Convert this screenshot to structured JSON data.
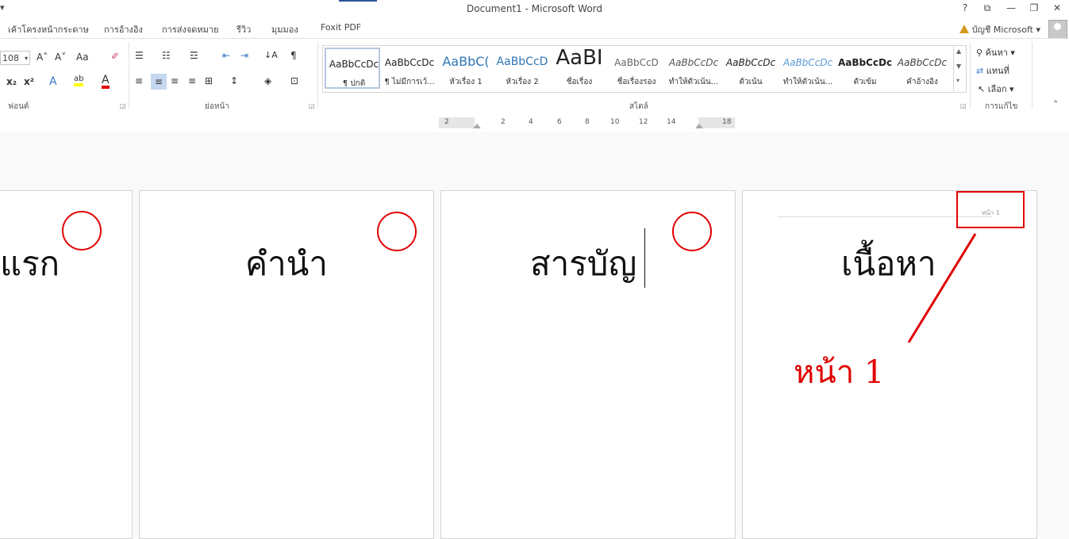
{
  "window": {
    "title": "Document1 - Microsoft Word",
    "help": "?",
    "ribbon_display": "⧉",
    "minimize": "—",
    "restore": "❐",
    "close": "✕"
  },
  "tabs": [
    {
      "label": "เค้าโครงหน้ากระดาษ"
    },
    {
      "label": "การอ้างอิง"
    },
    {
      "label": "การส่งจดหมาย"
    },
    {
      "label": "รีวิว"
    },
    {
      "label": "มุมมอง"
    },
    {
      "label": "Foxit PDF"
    }
  ],
  "account": {
    "label": "บัญชี Microsoft",
    "dropdown": "▾"
  },
  "ribbon": {
    "font": {
      "size_value": "108",
      "grow": "A˄",
      "shrink": "A˅",
      "change_case": "Aa",
      "clear_format": "✐",
      "subscript": "x₂",
      "superscript": "x²",
      "text_effects": "A",
      "highlight": "ab",
      "font_color": "A",
      "label": "ฟอนต์"
    },
    "paragraph": {
      "bullets": "☰",
      "numbering": "☷",
      "multilevel": "☲",
      "decrease_indent": "⇤",
      "increase_indent": "⇥",
      "sort": "↓A",
      "show_marks": "¶",
      "align_left": "≡",
      "align_center": "≡",
      "align_right": "≡",
      "justify": "≡",
      "distributed": "⊞",
      "line_spacing": "↕",
      "shading": "◈",
      "borders": "⊡",
      "label": "ย่อหน้า"
    },
    "styles": {
      "label": "สไตล์",
      "items": [
        {
          "sample": "AaBbCcDc",
          "name": "¶ ปกติ"
        },
        {
          "sample": "AaBbCcDc",
          "name": "¶ ไม่มีการเว้..."
        },
        {
          "sample": "AaBbC(",
          "name": "หัวเรื่อง 1"
        },
        {
          "sample": "AaBbCcD",
          "name": "หัวเรื่อง 2"
        },
        {
          "sample": "AaBI",
          "name": "ชื่อเรื่อง"
        },
        {
          "sample": "AaBbCcD",
          "name": "ชื่อเรื่องรอง"
        },
        {
          "sample": "AaBbCcDc",
          "name": "ทำให้ตัวเน้น..."
        },
        {
          "sample": "AaBbCcDc",
          "name": "ตัวเน้น"
        },
        {
          "sample": "AaBbCcDc",
          "name": "ทำให้ตัวเน้น..."
        },
        {
          "sample": "AaBbCcDc",
          "name": "ตัวเข้ม"
        },
        {
          "sample": "AaBbCcDc",
          "name": "คำอ้างอิง"
        }
      ],
      "scroll_up": "▲",
      "scroll_down": "▼",
      "more": "▾"
    },
    "editing": {
      "find": "ค้นหา",
      "replace": "แทนที่",
      "select": "เลือก",
      "label": "การแก้ไข"
    }
  },
  "ruler": {
    "numbers": [
      "2",
      "2",
      "4",
      "6",
      "8",
      "10",
      "12",
      "14",
      "18"
    ]
  },
  "document": {
    "pages": [
      {
        "heading": "แรก"
      },
      {
        "heading": "คำนำ"
      },
      {
        "heading": "สารบัญ"
      },
      {
        "heading": "เนื้อหา"
      }
    ],
    "header_text": "หน้า 1",
    "annotation": "หน้า 1"
  },
  "colors": {
    "annotation_red": "#e00000",
    "word_blue": "#2b579a"
  }
}
